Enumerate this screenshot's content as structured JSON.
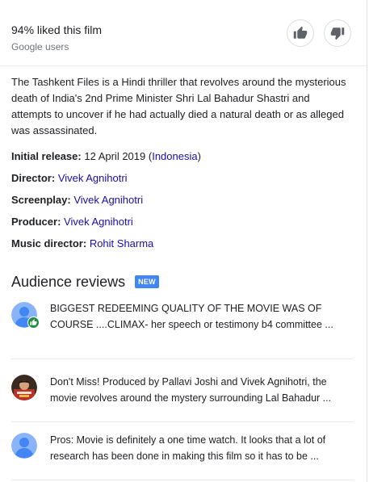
{
  "rating": {
    "title": "94% liked this film",
    "subtitle": "Google users"
  },
  "description": "The Tashkent Files is a Hindi thriller that revolves around the mysterious death of India's 2nd Prime Minister Shri Lal Bahadur Shastri and attempts to uncover if he had actually died a natural death or as alleged was assassinated.",
  "facts": {
    "release": {
      "label": "Initial release:",
      "date": "12 April 2019",
      "open": "(",
      "country": "Indonesia",
      "close": ")"
    },
    "director": {
      "label": "Director:",
      "value": "Vivek Agnihotri"
    },
    "screenplay": {
      "label": "Screenplay:",
      "value": "Vivek Agnihotri"
    },
    "producer": {
      "label": "Producer:",
      "value": "Vivek Agnihotri"
    },
    "music": {
      "label": "Music director:",
      "value": "Rohit Sharma"
    }
  },
  "reviews": {
    "title": "Audience reviews",
    "badge": "NEW",
    "items": [
      {
        "text": "BIGGEST REDEEMING QUALITY OF THE MOVIE WAS OF COURSE ....CLIMAX- her speech or testimony b4 committee ..."
      },
      {
        "text": "Don't Miss! Produced by Pallavi Joshi and Vivek Agnihotri, the movie revolves around the mystery surrounding Lal Bahadur ..."
      },
      {
        "text": "Pros: Movie is definitely a one time watch. It looks that a lot of research has been done in making this film so it has to be ..."
      }
    ]
  },
  "colors": {
    "link": "#1a0dab",
    "badge": "#4285f4",
    "avatar_default": "#8ab4f8",
    "like_badge": "#1e8e3e"
  }
}
